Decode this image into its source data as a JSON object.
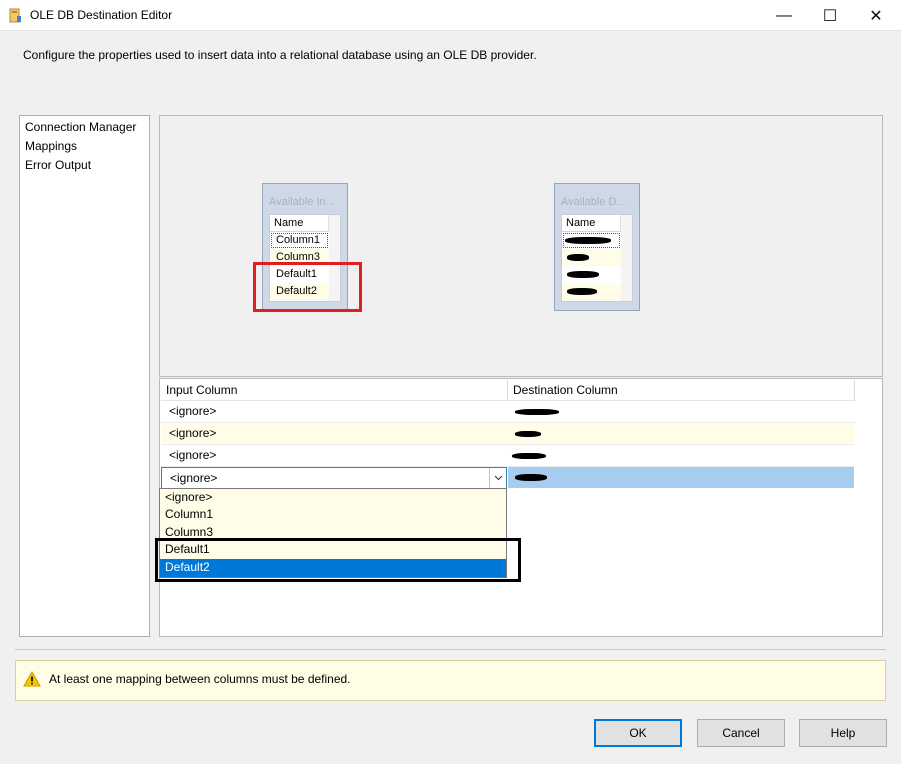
{
  "window": {
    "title": "OLE DB Destination Editor",
    "minimize_glyph": "—",
    "maximize_glyph": "☐",
    "close_glyph": "✕"
  },
  "description": "Configure the properties used to insert data into a relational database using an OLE DB provider.",
  "nav": {
    "items": [
      {
        "label": "Connection Manager"
      },
      {
        "label": "Mappings"
      },
      {
        "label": "Error Output"
      }
    ]
  },
  "input_table": {
    "title": "Available In...",
    "header": "Name",
    "columns": [
      "Column1",
      "Column3",
      "Default1",
      "Default2"
    ]
  },
  "destination_table": {
    "title": "Available D...",
    "header": "Name"
  },
  "grid": {
    "headers": {
      "input": "Input Column",
      "destination": "Destination Column"
    },
    "rows": [
      {
        "input": "<ignore>"
      },
      {
        "input": "<ignore>"
      },
      {
        "input": "<ignore>"
      },
      {
        "input": "<ignore>"
      }
    ]
  },
  "dropdown": {
    "options": [
      "<ignore>",
      "Column1",
      "Column3",
      "Default1",
      "Default2"
    ],
    "selected": "Default2"
  },
  "warning": {
    "text": "At least one mapping between columns must be defined.",
    "icon": "warning-icon",
    "icon_color": "#f5c400"
  },
  "buttons": {
    "ok": "OK",
    "cancel": "Cancel",
    "help": "Help"
  },
  "colors": {
    "selection": "#0078d7",
    "highlight_red": "#e02020",
    "row_highlight": "#a6cdf0"
  }
}
